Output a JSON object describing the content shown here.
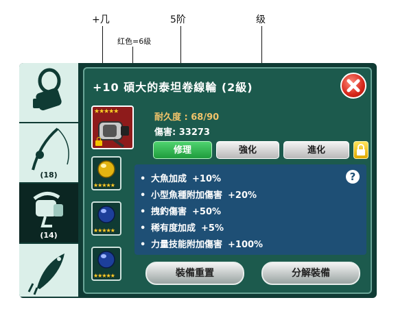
{
  "annotations": {
    "plus_level": "+几",
    "tier": "5阶",
    "grade": "级",
    "red_note": "红色=6级"
  },
  "side_tabs": [
    {
      "name": "hook-line",
      "icon": "hook-line-icon",
      "count": ""
    },
    {
      "name": "fishing-rod",
      "icon": "fishing-rod-icon",
      "count": "(18)"
    },
    {
      "name": "reel",
      "icon": "reel-icon",
      "count": "(14)"
    },
    {
      "name": "lure",
      "icon": "lure-icon",
      "count": ""
    }
  ],
  "item": {
    "title": "+10 碩大的泰坦卷線輪 (2級)",
    "stars": "★★★★★",
    "durability": "耐久度 : 68/90",
    "damage": "傷害: 33273"
  },
  "buttons": {
    "repair": "修理",
    "strengthen": "強化",
    "evolve": "進化",
    "reset": "裝備重置",
    "decompose": "分解裝備"
  },
  "gems": [
    {
      "icon": "gold-orb-icon",
      "stars": "★★★★★",
      "color": "#e3b411"
    },
    {
      "icon": "blue-orb-icon",
      "stars": "★★★★★",
      "color": "#1d3f9a"
    },
    {
      "icon": "blue-orb-icon",
      "stars": "★★★★★",
      "color": "#1d3f9a"
    }
  ],
  "effects": [
    {
      "label": "大魚加成",
      "value": "+10%"
    },
    {
      "label": "小型魚種附加傷害",
      "value": "+20%"
    },
    {
      "label": "拽釣傷害",
      "value": "+50%"
    },
    {
      "label": "稀有度加成",
      "value": "+5%"
    },
    {
      "label": "力量技能附加傷害",
      "value": "+100%"
    }
  ],
  "help": "?",
  "colors": {
    "panel": "#1c5a4d",
    "effects_bg": "#1e4f75",
    "durability": "#f1c36a",
    "item_bg": "#8e1b1b"
  }
}
